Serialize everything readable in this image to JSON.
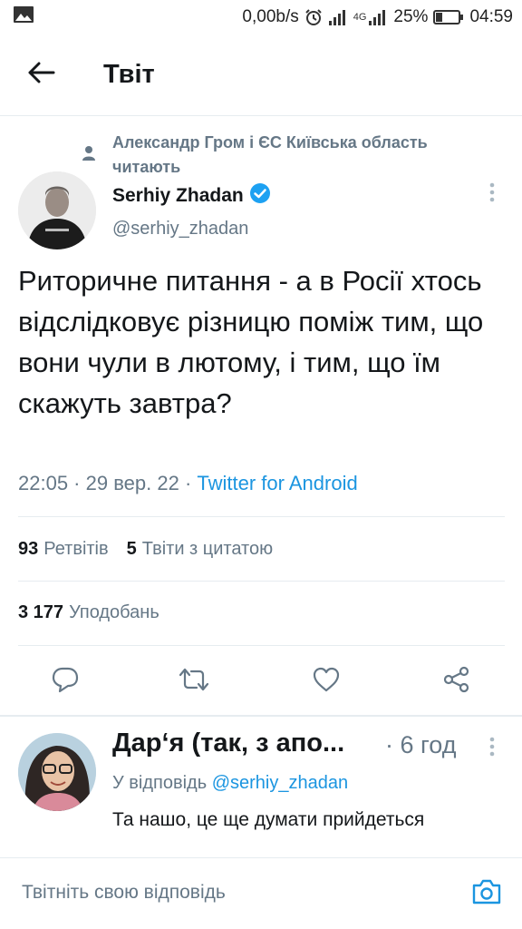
{
  "status_bar": {
    "speed": "0,00b/s",
    "network": "4G",
    "battery": "25%",
    "time": "04:59",
    "icons": [
      "image-icon",
      "alarm-icon",
      "signal-icon",
      "battery-icon"
    ]
  },
  "header": {
    "title": "Твіт",
    "back_icon": "arrow-left-icon"
  },
  "tweet": {
    "social_context": "Александр Гром і ЄС Київська область читають",
    "author_name": "Serhiy Zhadan",
    "verified": true,
    "author_handle": "@serhiy_zhadan",
    "text": "Риторичне питання - а в Росії хтось відслідковує різницю поміж тим, що вони чули в лютому, і тим, що їм скажуть завтра?",
    "time": "22:05",
    "date": "29 вер. 22",
    "separator": " · ",
    "source": "Twitter for Android",
    "retweets_count": "93",
    "retweets_label": "Ретвітів",
    "quotes_count": "5",
    "quotes_label": "Твіти з цитатою",
    "likes_count": "3 177",
    "likes_label": "Уподобань",
    "actions": [
      "reply-icon",
      "retweet-icon",
      "like-icon",
      "share-icon"
    ]
  },
  "reply": {
    "name": "Дар‘я (так, з апо...",
    "time": "· 6 год",
    "reply_prefix": "У відповідь",
    "reply_to": "@serhiy_zhadan",
    "text": "Та нашо, це ще думати прийдеться"
  },
  "compose": {
    "placeholder": "Твітніть свою відповідь"
  },
  "colors": {
    "accent": "#1b95e0",
    "secondary_text": "#657786",
    "divider": "#e6ecf0"
  }
}
